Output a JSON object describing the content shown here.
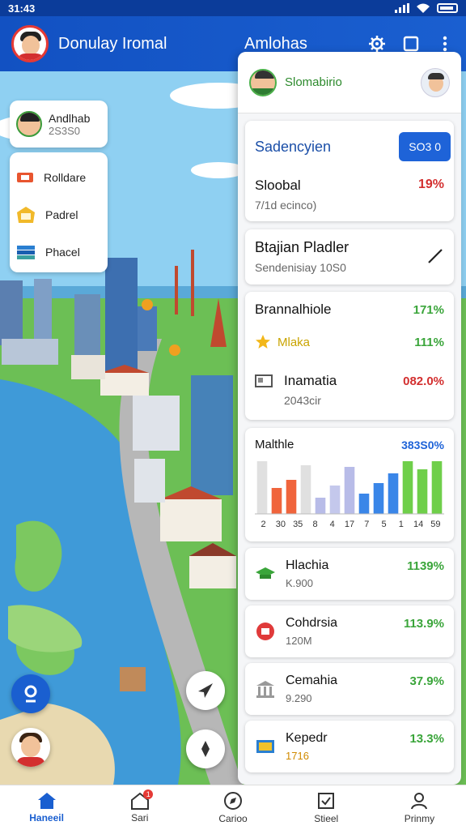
{
  "status_bar": {
    "time": "31:43"
  },
  "app_bar": {
    "title": "Donulay Iromal",
    "center_label": "Amlohas"
  },
  "map_overlay": {
    "user_card": {
      "name": "Andlhab",
      "value": "2S3S0"
    },
    "menu": [
      {
        "label": "Rolldare",
        "icon": "id-card-icon"
      },
      {
        "label": "Padrel",
        "icon": "frame-icon"
      },
      {
        "label": "Phacel",
        "icon": "stack-icon"
      }
    ]
  },
  "panel": {
    "header": {
      "title": "Slomabirio"
    },
    "summary": {
      "title": "Sadencyien",
      "button": "SO3 0",
      "label": "Sloobal",
      "value": "19%",
      "sub": "7/1d ecinco)"
    },
    "bravian": {
      "title": "Btajian Pladler",
      "sub": "Sendenisiay 10S0"
    },
    "stats": {
      "title": "Brannalhiole",
      "title_value": "171%",
      "star_label": "Mlaka",
      "star_value": "111%",
      "ins_label": "Inamatia",
      "ins_value": "082.0%",
      "ins_sub": "2043cir"
    },
    "chart_card": {
      "title": "Malthle",
      "value": "383S0%"
    },
    "list": [
      {
        "title": "Hlachia",
        "sub": "K.900",
        "value": "1139%",
        "icon": "graduation-cap-icon"
      },
      {
        "title": "Cohdrsia",
        "sub": "120M",
        "value": "113.9%",
        "icon": "badge-icon"
      },
      {
        "title": "Cemahia",
        "sub": "9.290",
        "value": "37.9%",
        "icon": "building-icon"
      },
      {
        "title": "Kepedr",
        "sub": "1716",
        "value": "13.3%",
        "icon": "book-icon"
      }
    ]
  },
  "chart_data": {
    "type": "bar",
    "categories": [
      "2",
      "30",
      "35",
      "8",
      "4",
      "17",
      "7",
      "5",
      "1",
      "14",
      "59"
    ],
    "values": [
      6.5,
      3.2,
      4.2,
      6.0,
      2.0,
      3.5,
      5.8,
      2.5,
      3.8,
      5.0,
      6.5,
      5.5,
      6.5
    ],
    "colors": [
      "#e0e0e0",
      "#f0643c",
      "#f0643c",
      "#e0e0e0",
      "#b8bce8",
      "#c4c8ec",
      "#b8bce8",
      "#3a86e8",
      "#3a86e8",
      "#3a86e8",
      "#6fcf4a",
      "#6fcf4a",
      "#6fcf4a"
    ]
  },
  "bottom_nav": [
    {
      "label": "Haneeil",
      "icon": "home-icon",
      "active": true
    },
    {
      "label": "Sari",
      "icon": "store-icon",
      "badge": "1"
    },
    {
      "label": "Carioo",
      "icon": "compass-icon"
    },
    {
      "label": "Stieel",
      "icon": "checklist-icon"
    },
    {
      "label": "Prinmy",
      "icon": "profile-icon"
    }
  ]
}
